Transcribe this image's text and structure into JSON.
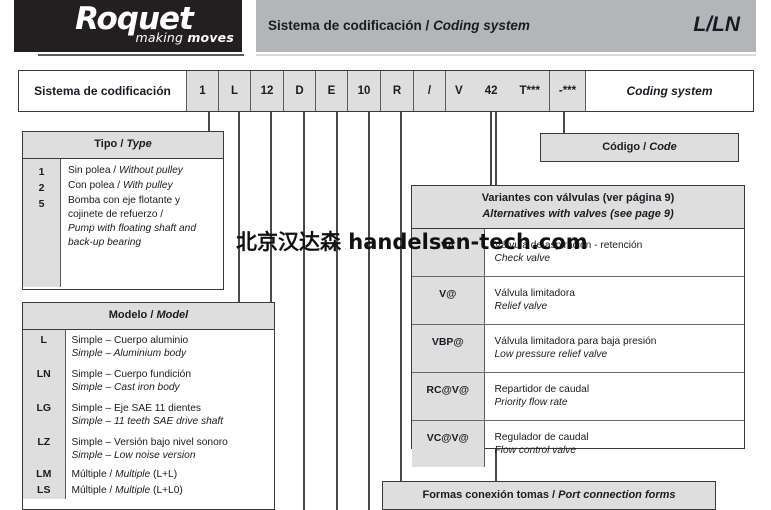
{
  "header": {
    "logo_word": "Roquet",
    "logo_tagline_light": "making ",
    "logo_tagline_bold": "moves",
    "title_es": "Sistema de codificación / ",
    "title_en": "Coding system",
    "product_code": "L/LN"
  },
  "coding_row": {
    "label_es": "Sistema de codificación",
    "label_en": "Coding system",
    "cells": [
      "1",
      "L",
      "12",
      "D",
      "E",
      "10",
      "R",
      "/"
    ],
    "valve_cell": [
      "V",
      "42",
      "T***"
    ],
    "suffix_cell": "-***"
  },
  "tipo": {
    "head_es": "Tipo / ",
    "head_en": "Type",
    "keys": [
      "1",
      "2",
      "5"
    ],
    "rows": [
      {
        "key": "1",
        "es": "Sin polea / ",
        "en": "Without pulley"
      },
      {
        "key": "2",
        "es": "Con polea / ",
        "en": "With pulley"
      },
      {
        "key": "5",
        "es": "Bomba con eje flotante y cojinete de refuerzo /",
        "en": "Pump with floating shaft and back-up bearing"
      }
    ]
  },
  "modelo": {
    "head_es": "Modelo / ",
    "head_en": "Model",
    "rows": [
      {
        "key": "L",
        "es": "Simple – Cuerpo aluminio",
        "en": "Simple – Aluminium body"
      },
      {
        "key": "LN",
        "es": "Simple – Cuerpo fundición",
        "en": "Simple – Cast iron body"
      },
      {
        "key": "LG",
        "es": "Simple – Eje SAE 11 dientes",
        "en": "Simple – 11 teeth SAE drive shaft"
      },
      {
        "key": "LZ",
        "es": "Simple – Versión bajo nivel sonoro",
        "en": "Simple – Low noise version"
      },
      {
        "key": "LM",
        "es": "Múltiple / ",
        "en": "Multiple",
        "tail": " (L+L)"
      },
      {
        "key": "LS",
        "es": "Múltiple / ",
        "en": "Multiple",
        "tail": " (L+L0)"
      }
    ]
  },
  "codigo": {
    "head_es": "Código / ",
    "head_en": "Code"
  },
  "valvulas": {
    "head_es": "Variantes con válvulas (ver página 9)",
    "head_en": "Alternatives with valves (see page 9)",
    "rows": [
      {
        "key": "VA",
        "es": "Válvula de aspiración - retención",
        "en": "Check valve"
      },
      {
        "key": "V@",
        "es": "Válvula limitadora",
        "en": "Relief valve"
      },
      {
        "key": "VBP@",
        "es": "Válvula limitadora para baja presión",
        "en": "Low pressure relief valve"
      },
      {
        "key": "RC@V@",
        "es": "Repartidor de caudal",
        "en": "Priority flow rate"
      },
      {
        "key": "VC@V@",
        "es": "Regulador de caudal",
        "en": "Flow control valve"
      }
    ]
  },
  "formas": {
    "head_es": "Formas conexión tomas / ",
    "head_en": "Port connection forms"
  },
  "watermark": {
    "text": "北京汉达森 handelsen-tech.com"
  },
  "colors": {
    "logo_bg": "#231f20",
    "header_bg": "#b3b6b9",
    "cell_fill": "#dedede",
    "border": "#3a3a3a",
    "text": "#1a1a22"
  }
}
